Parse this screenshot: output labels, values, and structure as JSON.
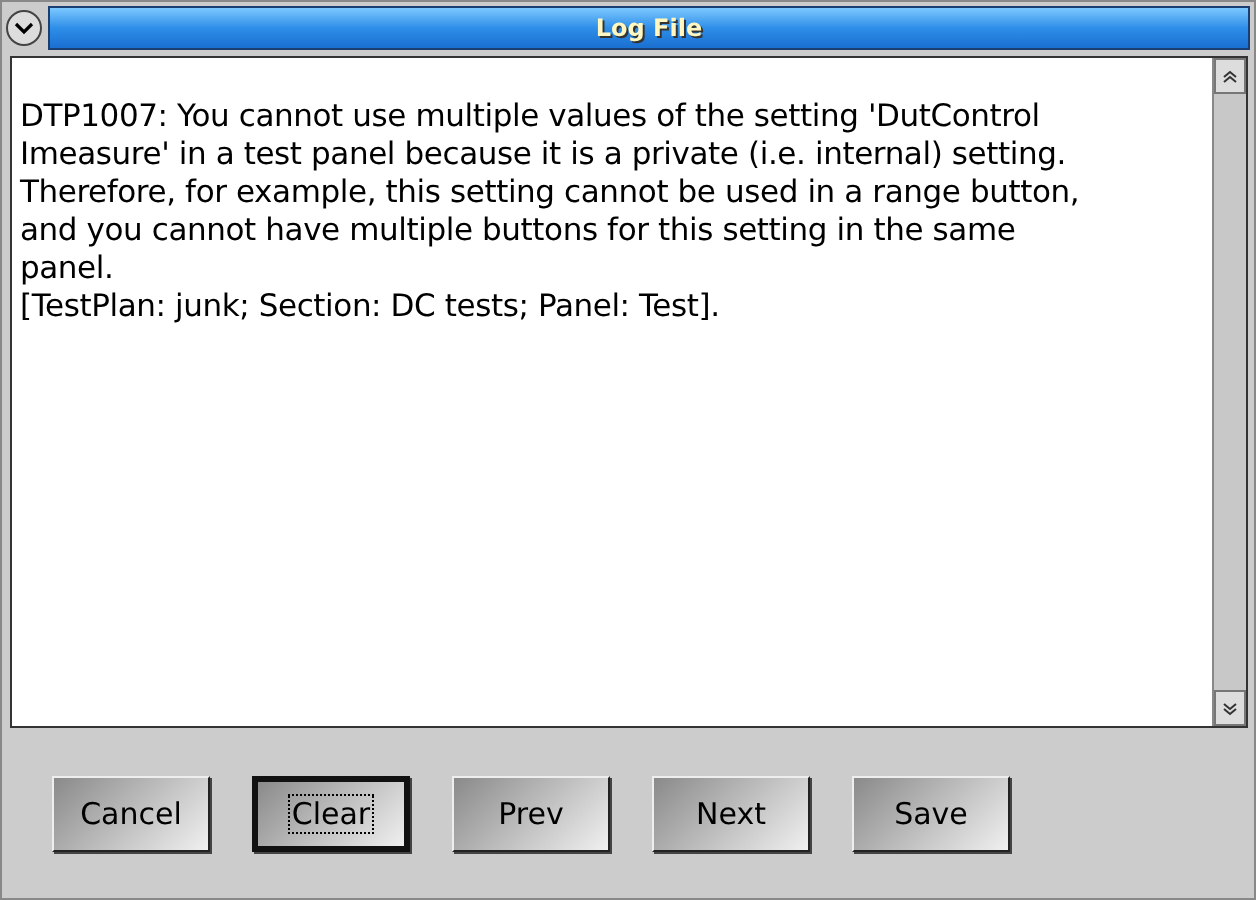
{
  "window": {
    "title": "Log File"
  },
  "log": {
    "text": "DTP1007: You cannot use multiple values of the setting 'DutControl\nImeasure' in a test panel because it is a private (i.e. internal) setting.\nTherefore, for example, this setting cannot be used in a range button,\nand you cannot have multiple buttons for this setting in the same\npanel.\n[TestPlan: junk; Section: DC tests; Panel: Test]."
  },
  "buttons": [
    {
      "label": "Cancel",
      "focused": false
    },
    {
      "label": "Clear",
      "focused": true
    },
    {
      "label": "Prev",
      "focused": false
    },
    {
      "label": "Next",
      "focused": false
    },
    {
      "label": "Save",
      "focused": false
    }
  ]
}
